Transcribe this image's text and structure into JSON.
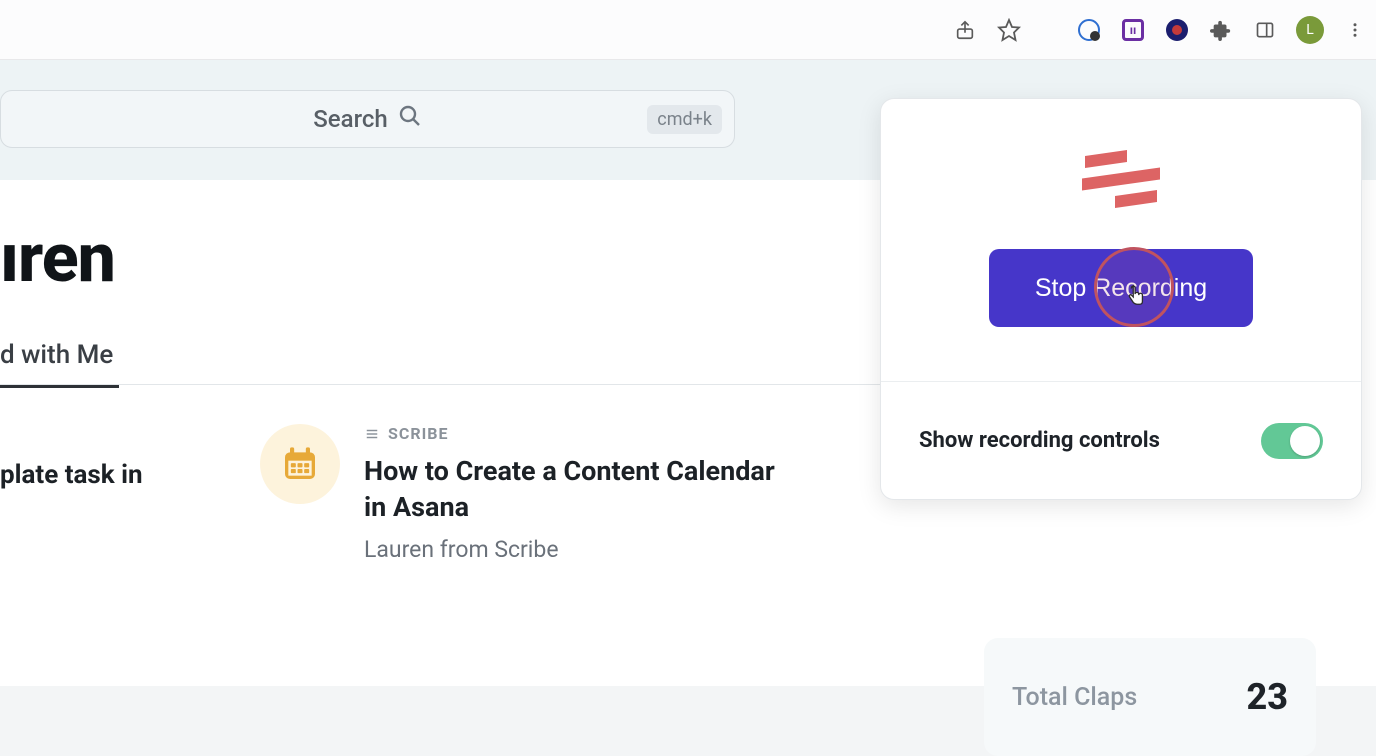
{
  "chrome": {
    "avatar_initial": "L"
  },
  "search": {
    "placeholder": "Search",
    "shortcut": "cmd+k"
  },
  "main": {
    "heading_fragment": "ıren",
    "tab_label_fragment": "d with Me",
    "card_left_title_fragment": "plate task in",
    "card2": {
      "type_label": "SCRIBE",
      "title": "How to Create a Content Calendar in Asana",
      "author": "Lauren from Scribe"
    }
  },
  "sidebar": {
    "stat_label": "Total Claps",
    "stat_value": "23"
  },
  "popup": {
    "stop_label": "Stop Recording",
    "toggle_label": "Show recording controls",
    "toggle_on": true
  }
}
